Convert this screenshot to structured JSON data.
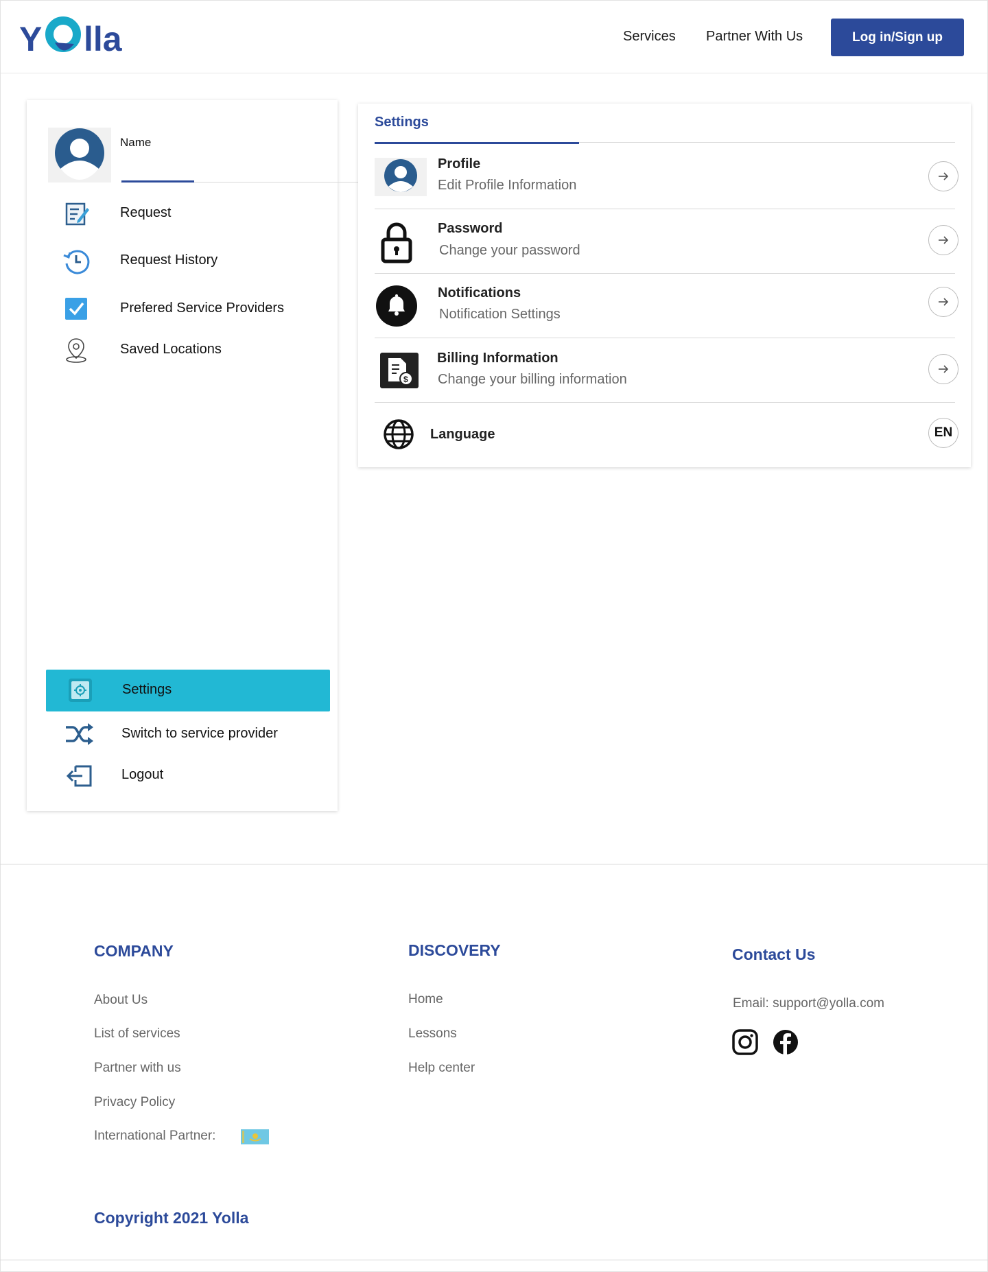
{
  "header": {
    "logo_text": "Yolla",
    "nav": [
      {
        "label": "Services"
      },
      {
        "label": "Partner With Us"
      }
    ],
    "login_label": "Log in/Sign up"
  },
  "sidebar": {
    "user_name": "Name",
    "items": [
      {
        "label": "Request",
        "icon": "request-form-icon"
      },
      {
        "label": "Request History",
        "icon": "history-clock-icon"
      },
      {
        "label": "Prefered Service Providers",
        "icon": "checkbox-checked-icon"
      },
      {
        "label": "Saved Locations",
        "icon": "location-pin-icon"
      }
    ],
    "bottom": [
      {
        "label": "Settings",
        "icon": "settings-gear-icon",
        "active": true
      },
      {
        "label": "Switch to service provider",
        "icon": "shuffle-icon"
      },
      {
        "label": "Logout",
        "icon": "logout-icon"
      }
    ]
  },
  "settings": {
    "title": "Settings",
    "rows": [
      {
        "title": "Profile",
        "subtitle": "Edit Profile Information",
        "icon": "user-avatar-icon"
      },
      {
        "title": "Password",
        "subtitle": "Change your password",
        "icon": "lock-icon"
      },
      {
        "title": "Notifications",
        "subtitle": "Notification Settings",
        "icon": "bell-icon"
      },
      {
        "title": "Billing Information",
        "subtitle": "Change your billing information",
        "icon": "billing-document-icon"
      }
    ],
    "language": {
      "title": "Language",
      "value": "EN",
      "icon": "globe-icon"
    }
  },
  "footer": {
    "company": {
      "heading": "COMPANY",
      "links": [
        "About Us",
        "List of services",
        "Partner with us",
        "Privacy Policy",
        "International Partner:"
      ]
    },
    "discovery": {
      "heading": "DISCOVERY",
      "links": [
        "Home",
        "Lessons",
        "Help center"
      ]
    },
    "contact": {
      "heading": "Contact Us",
      "email": "Email: support@yolla.com"
    },
    "copyright": "Copyright 2021 Yolla"
  },
  "colors": {
    "brand_blue": "#2c4a9a",
    "accent_cyan": "#22b8d4",
    "logo_teal": "#19a9c9"
  }
}
